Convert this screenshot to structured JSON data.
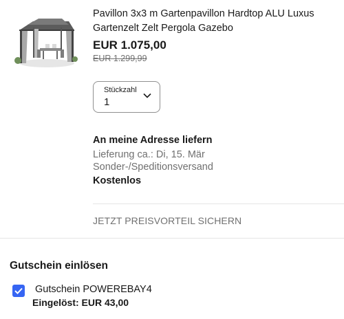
{
  "product": {
    "title": "Pavillon 3x3 m Gartenpavillon Hardtop ALU Luxus Gartenzelt Zelt Pergola Gazebo",
    "price": "EUR 1.075,00",
    "original_price": "EUR 1.299,99"
  },
  "quantity": {
    "label": "Stückzahl",
    "value": "1"
  },
  "shipping": {
    "heading": "An meine Adresse liefern",
    "delivery": "Lieferung ca.: Di, 15. Mär",
    "method": "Sonder-/Speditionsversand",
    "cost": "Kostenlos"
  },
  "promo": {
    "link_label": "JETZT PREISVORTEIL SICHERN"
  },
  "coupon": {
    "heading": "Gutschein einlösen",
    "code_label": "Gutschein POWEREBAY4",
    "redeemed_label": "Eingelöst: EUR 43,00",
    "checked": true,
    "check_color": "#3665f3"
  }
}
